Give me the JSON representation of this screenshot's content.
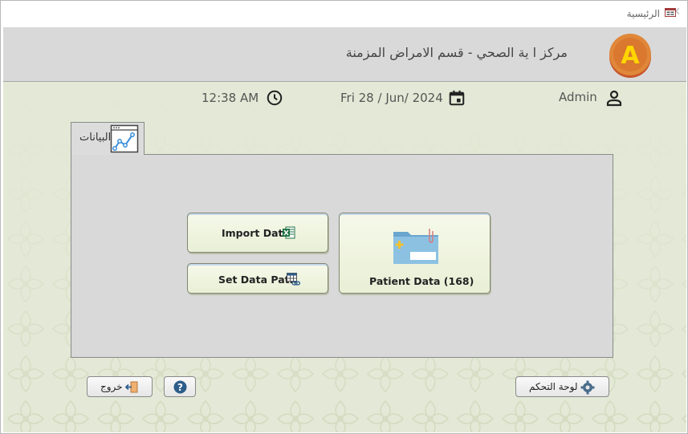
{
  "window": {
    "title": "الرئيسية"
  },
  "header": {
    "title": "مركز ا      ية الصحي - قسم الامراض المزمنة",
    "logo_letter": "A"
  },
  "infobar": {
    "time": "12:38 AM",
    "date": "Fri 28 / Jun/ 2024",
    "user": "Admin"
  },
  "tabs": [
    {
      "label": "البيانات"
    }
  ],
  "buttons": {
    "import_data": "Import Data",
    "set_data_path": "Set Data Path",
    "patient_data": "Patient Data (168)"
  },
  "footer": {
    "exit": "خروج",
    "help": "?",
    "control_panel": "لوحة التحكم"
  },
  "colors": {
    "header_bg": "#d9d9d9",
    "body_bg": "#e3e9d6",
    "button_bg": "#eef3df",
    "logo_orange": "#d7752f",
    "logo_yellow": "#ffd500",
    "excel_green": "#1f7244",
    "help_blue": "#2d5d8a"
  },
  "icons": [
    "app-form-icon",
    "clock-icon",
    "calendar-icon",
    "user-icon",
    "chart-window-icon",
    "excel-icon",
    "table-link-icon",
    "folder-icon",
    "exit-icon",
    "help-icon",
    "gear-icon"
  ]
}
